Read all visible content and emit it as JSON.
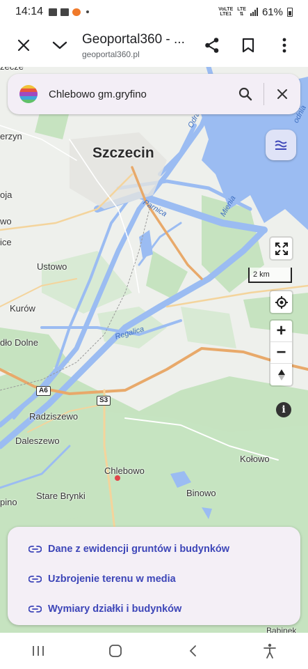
{
  "status_bar": {
    "time": "14:14",
    "network": "VoLTE",
    "network_sub": "LTE1",
    "lte": "LTE",
    "battery": "61%"
  },
  "browser": {
    "title": "Geoportal360 - ...",
    "url": "geoportal360.pl"
  },
  "search": {
    "value": "Chlebowo gm.gryfino"
  },
  "map": {
    "labels": {
      "city": "Szczecin",
      "ustowo": "Ustowo",
      "kurow": "Kurów",
      "dolne": "dło Dolne",
      "radziszewo": "Radziszewo",
      "dalszewo": "Daleszewo",
      "chlebowo": "Chlebowo",
      "stare_brynki": "Stare Brynki",
      "kolowo": "Kołowo",
      "binowo": "Binowo",
      "cut_top": "zecze",
      "cut_erzyn": "erzyn",
      "cut_oja": "oja",
      "cut_wo": "wo",
      "cut_ice": "ice",
      "cut_pino": "pino",
      "babinek": "Babinek",
      "odra": "Odra",
      "odnia": "odnia",
      "parnica": "Parnica",
      "mienia": "Mienia",
      "regalica": "Regalica",
      "road_a6": "A6",
      "road_s3": "S3"
    },
    "scale": "2 km"
  },
  "links": [
    {
      "label": "Dane z ewidencji gruntów i budynków"
    },
    {
      "label": "Uzbrojenie terenu w media"
    },
    {
      "label": "Wymiary działki i budynków"
    }
  ],
  "colors": {
    "water": "#9bbcf2",
    "green": "#c6e3c0",
    "road_major": "#e8a96a",
    "link_text": "#3d46b8",
    "layers_bg": "#dfe3f7",
    "card_bg": "#f3eef6"
  }
}
